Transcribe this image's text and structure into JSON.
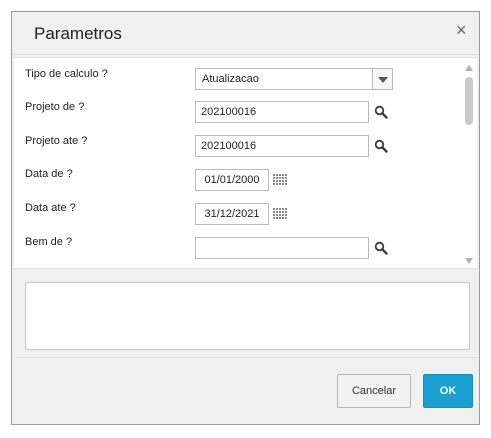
{
  "dialog": {
    "title": "Parametros",
    "close_glyph": "×"
  },
  "params": {
    "tipo_calculo": {
      "label": "Tipo de calculo ?",
      "value": "Atualizacao"
    },
    "projeto_de": {
      "label": "Projeto de ?",
      "value": "202100016"
    },
    "projeto_ate": {
      "label": "Projeto ate ?",
      "value": "202100016"
    },
    "data_de": {
      "label": "Data de ?",
      "value": "01/01/2000"
    },
    "data_ate": {
      "label": "Data ate ?",
      "value": "31/12/2021"
    },
    "bem_de": {
      "label": "Bem de ?",
      "value": ""
    }
  },
  "icons": {
    "search": "magnifier-icon",
    "calendar": "calendar-icon",
    "dropdown": "chevron-down-icon",
    "close": "close-icon"
  },
  "buttons": {
    "cancel": "Cancelar",
    "ok": "OK"
  },
  "colors": {
    "primary": "#1a9fd1",
    "icon": "#3c3c3c"
  }
}
